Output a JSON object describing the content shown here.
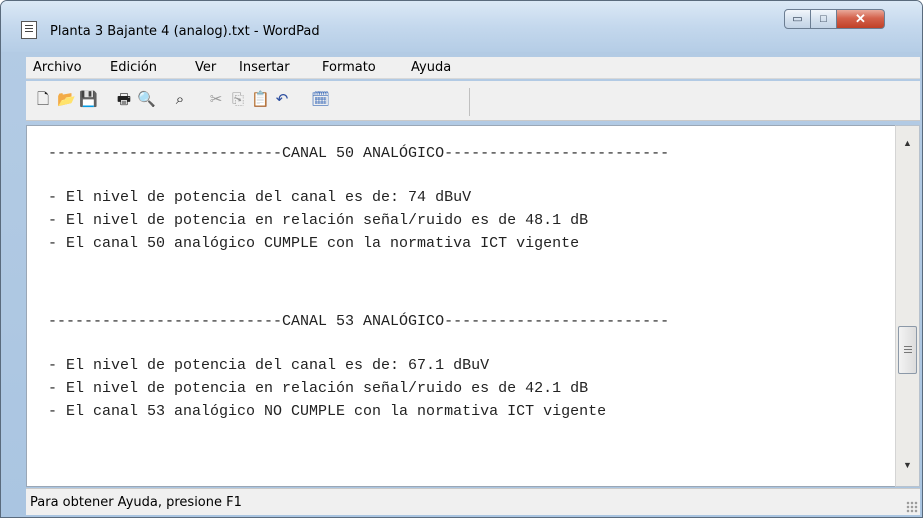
{
  "window": {
    "title": "Planta 3 Bajante 4 (analog).txt - WordPad",
    "min_label": "▭",
    "max_label": "□",
    "close_label": "✕"
  },
  "menu": {
    "items": [
      "Archivo",
      "Edición",
      "Ver",
      "Insertar",
      "Formato",
      "Ayuda"
    ]
  },
  "toolbar": {
    "icons": [
      "new-document-icon",
      "open-folder-icon",
      "save-disk-icon",
      "print-icon",
      "print-preview-icon",
      "find-binoculars-icon",
      "cut-scissors-icon",
      "copy-icon",
      "paste-icon",
      "undo-icon",
      "date-time-icon"
    ]
  },
  "document": {
    "lines": [
      "--------------------------CANAL 50 ANALÓGICO-------------------------",
      "",
      "- El nivel de potencia del canal es de: 74 dBuV",
      "- El nivel de potencia en relación señal/ruido es de 48.1 dB",
      "- El canal 50 analógico CUMPLE con la normativa ICT vigente",
      "",
      "",
      "--------------------------CANAL 53 ANALÓGICO-------------------------",
      "",
      "- El nivel de potencia del canal es de: 67.1 dBuV",
      "- El nivel de potencia en relación señal/ruido es de 42.1 dB",
      "- El canal 53 analógico NO CUMPLE con la normativa ICT vigente"
    ]
  },
  "status": {
    "text": "Para obtener Ayuda, presione F1"
  }
}
